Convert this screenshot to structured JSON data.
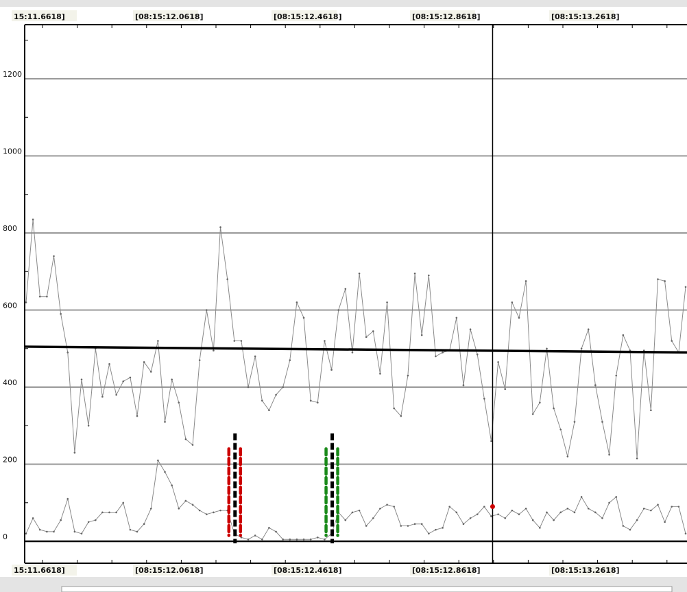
{
  "chart_data": {
    "type": "line",
    "x_tick_labels_top": [
      "15:11.6618]",
      "[08:15:12.0618]",
      "[08:15:12.4618]",
      "[08:15:12.8618]",
      "[08:15:13.2618]"
    ],
    "x_tick_labels_bottom": [
      "15:11.6618]",
      "[08:15:12.0618]",
      "[08:15:12.4618]",
      "[08:15:12.8618]",
      "[08:15:13.2618]"
    ],
    "y_ticks": [
      0,
      200,
      400,
      600,
      800,
      1000,
      1200
    ],
    "ylim": [
      -50,
      1350
    ],
    "n_samples": 96,
    "series": [
      {
        "values": [
          620,
          835,
          635,
          635,
          740,
          590,
          490,
          230,
          420,
          300,
          500,
          375,
          460,
          380,
          415,
          425,
          325,
          465,
          440,
          520,
          310,
          420,
          360,
          265,
          250,
          470,
          600,
          495,
          815,
          680,
          520,
          520,
          400,
          480,
          365,
          340,
          380,
          400,
          470,
          620,
          580,
          365,
          360,
          520,
          445,
          600,
          655,
          490,
          695,
          530,
          545,
          435,
          620,
          345,
          325,
          430,
          695,
          535,
          690,
          480,
          490,
          495,
          580,
          405,
          550,
          485,
          370,
          260,
          465,
          395,
          620,
          580,
          675,
          330,
          360,
          500,
          345,
          290,
          220,
          310,
          500,
          550,
          405,
          310,
          225,
          430,
          535,
          495,
          215,
          495,
          340,
          680,
          675,
          520,
          490,
          660
        ],
        "color": "#8a8a8a"
      },
      {
        "values": [
          20,
          60,
          30,
          25,
          25,
          55,
          110,
          25,
          20,
          50,
          55,
          75,
          75,
          75,
          100,
          30,
          25,
          45,
          85,
          210,
          180,
          145,
          85,
          105,
          95,
          80,
          70,
          75,
          80,
          80,
          20,
          10,
          5,
          15,
          5,
          35,
          25,
          5,
          5,
          5,
          5,
          5,
          10,
          5,
          20,
          75,
          55,
          75,
          80,
          40,
          60,
          85,
          95,
          90,
          40,
          40,
          45,
          45,
          20,
          30,
          35,
          90,
          75,
          45,
          60,
          70,
          90,
          65,
          70,
          60,
          80,
          70,
          85,
          55,
          35,
          75,
          55,
          75,
          85,
          75,
          115,
          85,
          75,
          60,
          100,
          115,
          40,
          30,
          55,
          85,
          80,
          95,
          50,
          90,
          90,
          20
        ],
        "color": "#8a8a8a"
      }
    ],
    "trend_line": {
      "start": 505,
      "end": 490,
      "color": "#000000"
    },
    "cursor_sample_index": 67,
    "markers": [
      {
        "type": "candle-red",
        "sample_index": 30,
        "low": -5,
        "high": 280,
        "body_low": 15,
        "body_high": 240
      },
      {
        "type": "candle-green",
        "sample_index": 44,
        "low": -5,
        "high": 280,
        "body_low": 15,
        "body_high": 240
      }
    ],
    "highlight_point": {
      "sample_index": 67,
      "value": 90,
      "color": "#cc0000"
    },
    "grid": true,
    "colors": {
      "background": "#ffffff",
      "frame": "#e4e4e4",
      "grid": "#999999",
      "zero_line": "#000000",
      "candle_red": "#cc0000",
      "candle_green": "#1a8a1a"
    }
  }
}
